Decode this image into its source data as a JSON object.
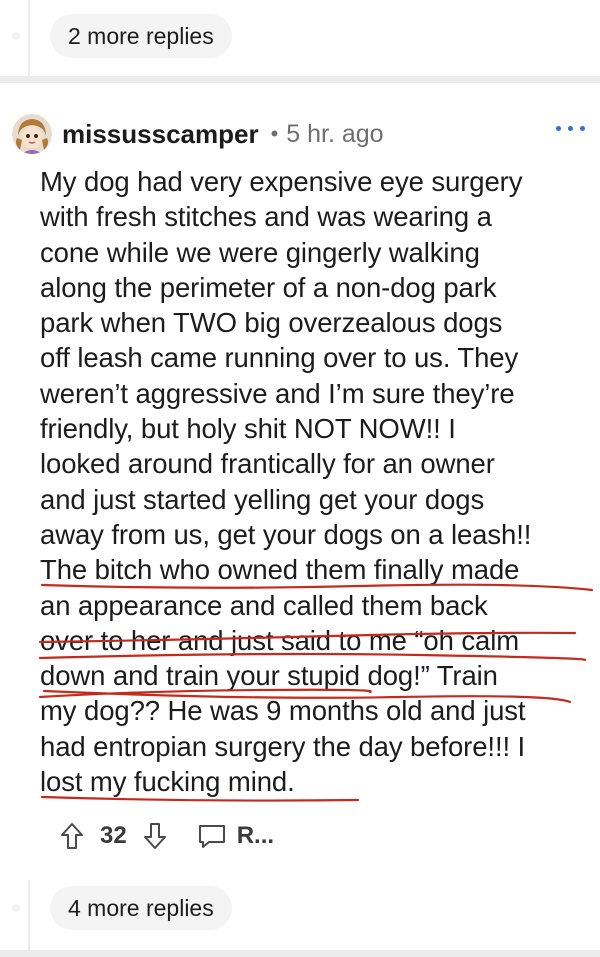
{
  "top_more_replies": "2 more replies",
  "comment": {
    "username": "missusscamper",
    "separator": "•",
    "time": "5 hr. ago",
    "lines": [
      "My dog had very expensive eye surgery",
      "with fresh stitches and was wearing a",
      "cone while we were gingerly walking",
      "along the perimeter of a non-dog park",
      "park when TWO big overzealous dogs",
      "off leash came running over to us. They",
      "weren’t aggressive and I’m sure they’re",
      "friendly, but holy shit NOT NOW!! I",
      "looked around frantically for an owner",
      "and just started yelling get your dogs",
      "away from us, get your dogs on a leash!!",
      "The bitch who owned them finally made",
      "an appearance and called them back",
      "over to her and just said to me “oh calm",
      "down and train your stupid dog!” Train",
      "my dog?? He was 9 months old and just",
      "had entropian surgery the day before!!! I",
      "lost my fucking mind."
    ],
    "vote_count": "32",
    "reply_label": "R..."
  },
  "bottom_more_replies": "4 more replies",
  "colors": {
    "annotation_red": "#c42b1c",
    "menu_blue": "#2f6fd6",
    "divider": "#ececec"
  },
  "icons": [
    "avatar",
    "more-options-icon",
    "upvote-icon",
    "downvote-icon",
    "comment-icon"
  ]
}
